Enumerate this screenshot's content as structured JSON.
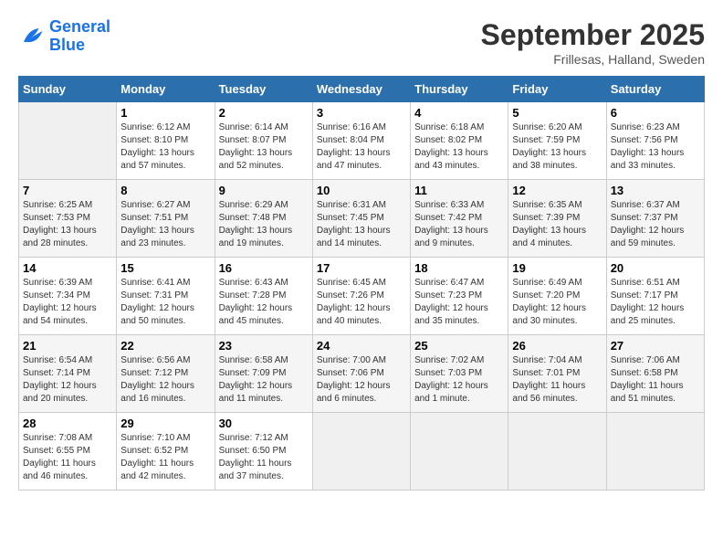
{
  "logo": {
    "text1": "General",
    "text2": "Blue"
  },
  "title": "September 2025",
  "location": "Frillesas, Halland, Sweden",
  "columns": [
    "Sunday",
    "Monday",
    "Tuesday",
    "Wednesday",
    "Thursday",
    "Friday",
    "Saturday"
  ],
  "weeks": [
    [
      {
        "day": "",
        "info": ""
      },
      {
        "day": "1",
        "info": "Sunrise: 6:12 AM\nSunset: 8:10 PM\nDaylight: 13 hours\nand 57 minutes."
      },
      {
        "day": "2",
        "info": "Sunrise: 6:14 AM\nSunset: 8:07 PM\nDaylight: 13 hours\nand 52 minutes."
      },
      {
        "day": "3",
        "info": "Sunrise: 6:16 AM\nSunset: 8:04 PM\nDaylight: 13 hours\nand 47 minutes."
      },
      {
        "day": "4",
        "info": "Sunrise: 6:18 AM\nSunset: 8:02 PM\nDaylight: 13 hours\nand 43 minutes."
      },
      {
        "day": "5",
        "info": "Sunrise: 6:20 AM\nSunset: 7:59 PM\nDaylight: 13 hours\nand 38 minutes."
      },
      {
        "day": "6",
        "info": "Sunrise: 6:23 AM\nSunset: 7:56 PM\nDaylight: 13 hours\nand 33 minutes."
      }
    ],
    [
      {
        "day": "7",
        "info": "Sunrise: 6:25 AM\nSunset: 7:53 PM\nDaylight: 13 hours\nand 28 minutes."
      },
      {
        "day": "8",
        "info": "Sunrise: 6:27 AM\nSunset: 7:51 PM\nDaylight: 13 hours\nand 23 minutes."
      },
      {
        "day": "9",
        "info": "Sunrise: 6:29 AM\nSunset: 7:48 PM\nDaylight: 13 hours\nand 19 minutes."
      },
      {
        "day": "10",
        "info": "Sunrise: 6:31 AM\nSunset: 7:45 PM\nDaylight: 13 hours\nand 14 minutes."
      },
      {
        "day": "11",
        "info": "Sunrise: 6:33 AM\nSunset: 7:42 PM\nDaylight: 13 hours\nand 9 minutes."
      },
      {
        "day": "12",
        "info": "Sunrise: 6:35 AM\nSunset: 7:39 PM\nDaylight: 13 hours\nand 4 minutes."
      },
      {
        "day": "13",
        "info": "Sunrise: 6:37 AM\nSunset: 7:37 PM\nDaylight: 12 hours\nand 59 minutes."
      }
    ],
    [
      {
        "day": "14",
        "info": "Sunrise: 6:39 AM\nSunset: 7:34 PM\nDaylight: 12 hours\nand 54 minutes."
      },
      {
        "day": "15",
        "info": "Sunrise: 6:41 AM\nSunset: 7:31 PM\nDaylight: 12 hours\nand 50 minutes."
      },
      {
        "day": "16",
        "info": "Sunrise: 6:43 AM\nSunset: 7:28 PM\nDaylight: 12 hours\nand 45 minutes."
      },
      {
        "day": "17",
        "info": "Sunrise: 6:45 AM\nSunset: 7:26 PM\nDaylight: 12 hours\nand 40 minutes."
      },
      {
        "day": "18",
        "info": "Sunrise: 6:47 AM\nSunset: 7:23 PM\nDaylight: 12 hours\nand 35 minutes."
      },
      {
        "day": "19",
        "info": "Sunrise: 6:49 AM\nSunset: 7:20 PM\nDaylight: 12 hours\nand 30 minutes."
      },
      {
        "day": "20",
        "info": "Sunrise: 6:51 AM\nSunset: 7:17 PM\nDaylight: 12 hours\nand 25 minutes."
      }
    ],
    [
      {
        "day": "21",
        "info": "Sunrise: 6:54 AM\nSunset: 7:14 PM\nDaylight: 12 hours\nand 20 minutes."
      },
      {
        "day": "22",
        "info": "Sunrise: 6:56 AM\nSunset: 7:12 PM\nDaylight: 12 hours\nand 16 minutes."
      },
      {
        "day": "23",
        "info": "Sunrise: 6:58 AM\nSunset: 7:09 PM\nDaylight: 12 hours\nand 11 minutes."
      },
      {
        "day": "24",
        "info": "Sunrise: 7:00 AM\nSunset: 7:06 PM\nDaylight: 12 hours\nand 6 minutes."
      },
      {
        "day": "25",
        "info": "Sunrise: 7:02 AM\nSunset: 7:03 PM\nDaylight: 12 hours\nand 1 minute."
      },
      {
        "day": "26",
        "info": "Sunrise: 7:04 AM\nSunset: 7:01 PM\nDaylight: 11 hours\nand 56 minutes."
      },
      {
        "day": "27",
        "info": "Sunrise: 7:06 AM\nSunset: 6:58 PM\nDaylight: 11 hours\nand 51 minutes."
      }
    ],
    [
      {
        "day": "28",
        "info": "Sunrise: 7:08 AM\nSunset: 6:55 PM\nDaylight: 11 hours\nand 46 minutes."
      },
      {
        "day": "29",
        "info": "Sunrise: 7:10 AM\nSunset: 6:52 PM\nDaylight: 11 hours\nand 42 minutes."
      },
      {
        "day": "30",
        "info": "Sunrise: 7:12 AM\nSunset: 6:50 PM\nDaylight: 11 hours\nand 37 minutes."
      },
      {
        "day": "",
        "info": ""
      },
      {
        "day": "",
        "info": ""
      },
      {
        "day": "",
        "info": ""
      },
      {
        "day": "",
        "info": ""
      }
    ]
  ]
}
